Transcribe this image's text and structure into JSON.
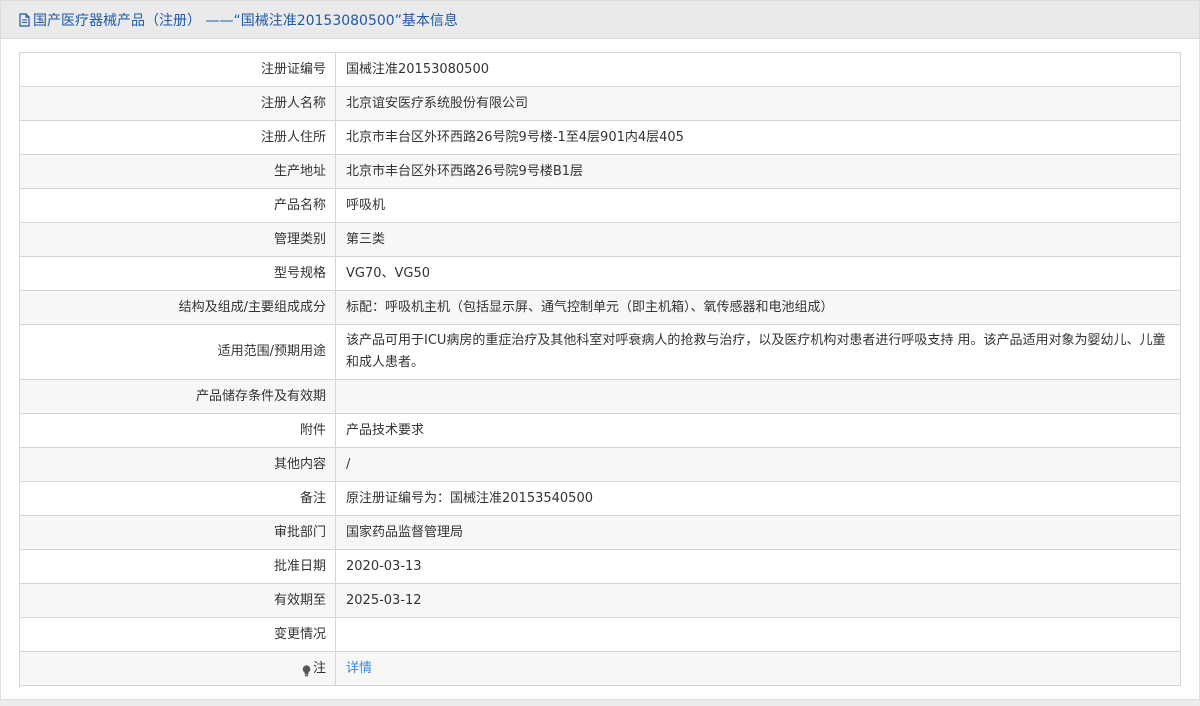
{
  "header": {
    "title": "国产医疗器械产品（注册） ——“国械注准20153080500”基本信息",
    "icon": "document-icon",
    "title_color": "#1f5aa6"
  },
  "rows": [
    {
      "label": "注册证编号",
      "value": "国械注准20153080500"
    },
    {
      "label": "注册人名称",
      "value": "北京谊安医疗系统股份有限公司"
    },
    {
      "label": "注册人住所",
      "value": "北京市丰台区外环西路26号院9号楼-1至4层901内4层405"
    },
    {
      "label": "生产地址",
      "value": "北京市丰台区外环西路26号院9号楼B1层"
    },
    {
      "label": "产品名称",
      "value": "呼吸机"
    },
    {
      "label": "管理类别",
      "value": "第三类"
    },
    {
      "label": "型号规格",
      "value": "VG70、VG50"
    },
    {
      "label": "结构及组成/主要组成成分",
      "value": "标配：呼吸机主机（包括显示屏、通气控制单元（即主机箱）、氧传感器和电池组成）"
    },
    {
      "label": "适用范围/预期用途",
      "value": "该产品可用于ICU病房的重症治疗及其他科室对呼衰病人的抢救与治疗，以及医疗机构对患者进行呼吸支持 用。该产品适用对象为婴幼儿、儿童和成人患者。"
    },
    {
      "label": "产品储存条件及有效期",
      "value": ""
    },
    {
      "label": "附件",
      "value": "产品技术要求"
    },
    {
      "label": "其他内容",
      "value": "/"
    },
    {
      "label": "备注",
      "value": "原注册证编号为：国械注准20153540500"
    },
    {
      "label": "审批部门",
      "value": "国家药品监督管理局"
    },
    {
      "label": "批准日期",
      "value": "2020-03-13"
    },
    {
      "label": "有效期至",
      "value": "2025-03-12"
    },
    {
      "label": "变更情况",
      "value": ""
    },
    {
      "label": "注",
      "value": "详情",
      "icon": "lightbulb-icon",
      "link_color": "#3a87d6"
    }
  ]
}
